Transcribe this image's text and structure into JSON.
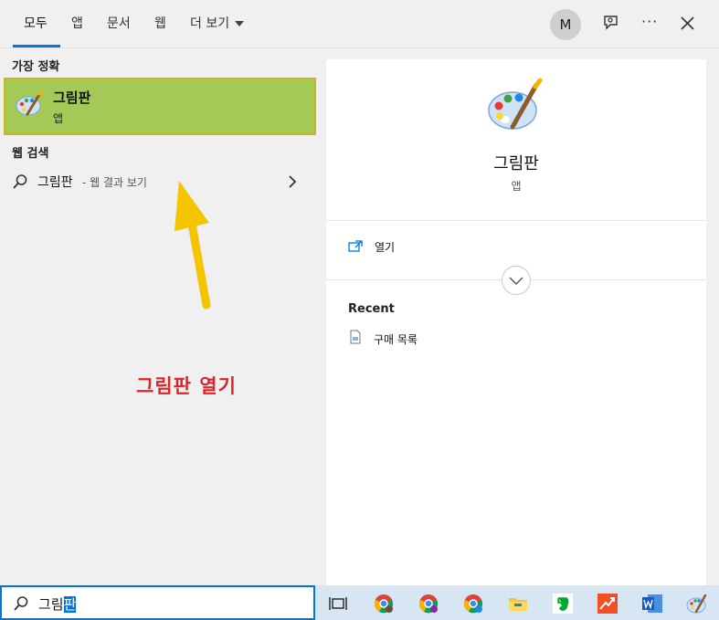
{
  "topbar": {
    "tabs": [
      {
        "label": "모두",
        "active": true
      },
      {
        "label": "앱",
        "active": false
      },
      {
        "label": "문서",
        "active": false
      },
      {
        "label": "웹",
        "active": false
      },
      {
        "label": "더 보기",
        "active": false
      }
    ],
    "avatar_initial": "M"
  },
  "left": {
    "best_match_title": "가장 정확",
    "best_match": {
      "name": "그림판",
      "type": "앱"
    },
    "web_search_title": "웹 검색",
    "web_search": {
      "query": "그림판",
      "suffix": " - 웹 결과 보기"
    }
  },
  "annotation": {
    "text": "그림판 열기",
    "color": "#e0232a",
    "arrow_color": "#f5c400"
  },
  "preview": {
    "name": "그림판",
    "type": "앱",
    "open_label": "열기",
    "recent_title": "Recent",
    "recent_items": [
      {
        "label": "구매 목록"
      }
    ]
  },
  "search": {
    "text_plain": "그림",
    "text_selected": "판"
  },
  "taskbar": {
    "icons": [
      "task-view-icon",
      "chrome-profile-1-icon",
      "chrome-profile-2-icon",
      "chrome-profile-3-icon",
      "file-explorer-icon",
      "evernote-icon",
      "chart-app-icon",
      "word-icon",
      "paint-icon"
    ]
  },
  "colors": {
    "accent": "#0078d7",
    "best_match_bg": "#a4c956"
  }
}
